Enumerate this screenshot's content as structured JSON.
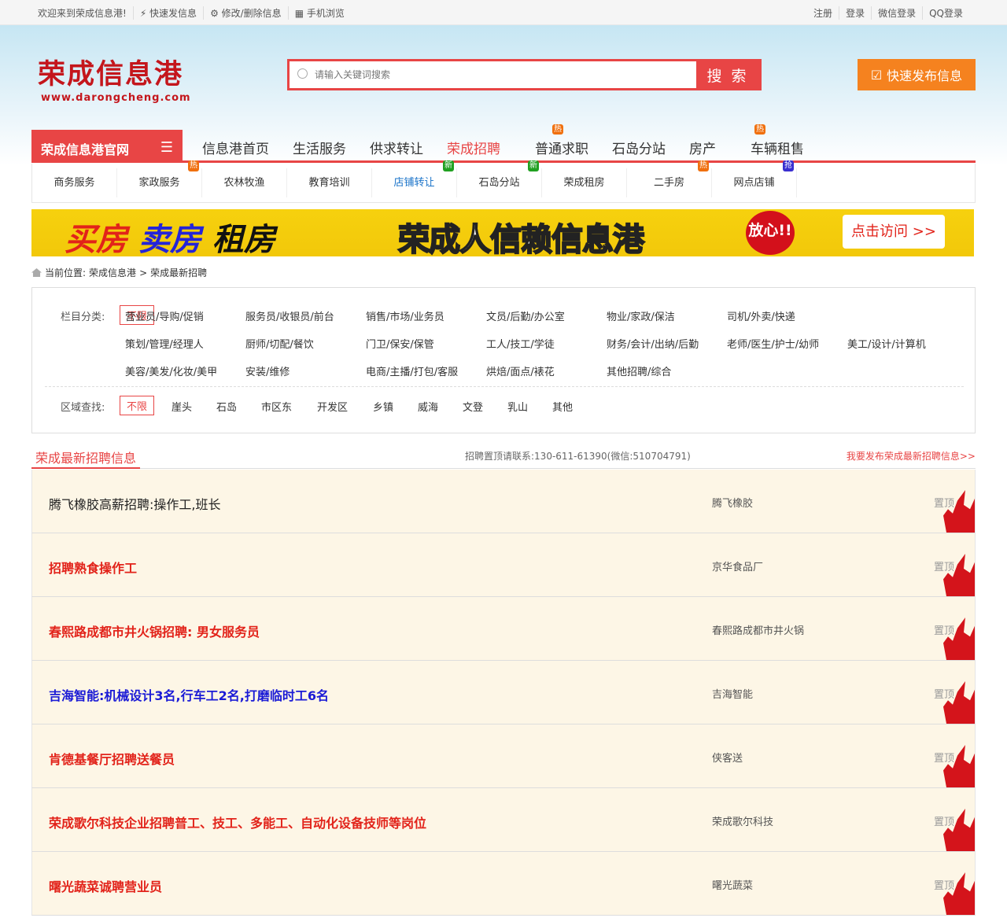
{
  "topbar": {
    "welcome": "欢迎来到荣成信息港!",
    "links": [
      "⚡ 快速发信息",
      "⚙ 修改/删除信息",
      "▦ 手机浏览"
    ],
    "right": [
      "注册",
      "登录",
      "微信登录",
      "QQ登录"
    ]
  },
  "logo": {
    "title": "荣成信息港",
    "url": "www.darongcheng.com"
  },
  "search": {
    "placeholder": "请输入关键词搜索",
    "button": "搜 索"
  },
  "publish": {
    "icon": "☑",
    "label": "快速发布信息"
  },
  "nav": {
    "home": "荣成信息港官网",
    "menu_icon": "☰",
    "items": [
      {
        "label": "信息港首页"
      },
      {
        "label": "生活服务"
      },
      {
        "label": "供求转让"
      },
      {
        "label": "荣成招聘",
        "badge": "热",
        "active": true
      },
      {
        "label": "普通求职"
      },
      {
        "label": "石岛分站"
      },
      {
        "label": "房产",
        "badge": "热"
      },
      {
        "label": "车辆租售"
      }
    ]
  },
  "subnav": [
    {
      "label": "商务服务"
    },
    {
      "label": "家政服务",
      "badge": "热"
    },
    {
      "label": "农林牧渔"
    },
    {
      "label": "教育培训"
    },
    {
      "label": "店铺转让",
      "badge": "新",
      "active": true
    },
    {
      "label": "石岛分站",
      "badge": "新"
    },
    {
      "label": "荣成租房"
    },
    {
      "label": "二手房",
      "badge": "热"
    },
    {
      "label": "网点店铺",
      "badge": "抢"
    }
  ],
  "banner": {
    "buy": "买房",
    "sell": "卖房",
    "rent": "租房",
    "slogan": "荣成人信赖信息港",
    "seal": "放心!!",
    "visit": "点击访问 >>"
  },
  "breadcrumb": {
    "prefix": "当前位置:",
    "home": "荣成信息港",
    "sep": ">",
    "current": "荣成最新招聘"
  },
  "filter": {
    "category_label": "栏目分类:",
    "all": "不限",
    "categories": [
      "营业员/导购/促销",
      "服务员/收银员/前台",
      "销售/市场/业务员",
      "文员/后勤/办公室",
      "物业/家政/保洁",
      "司机/外卖/快递",
      "策划/管理/经理人",
      "厨师/切配/餐饮",
      "门卫/保安/保管",
      "工人/技工/学徒",
      "财务/会计/出纳/后勤",
      "老师/医生/护士/幼师",
      "美工/设计/计算机",
      "美容/美发/化妆/美甲",
      "安装/维修",
      "电商/主播/打包/客服",
      "烘焙/面点/裱花",
      "其他招聘/综合"
    ],
    "area_label": "区域查找:",
    "areas": [
      "崖头",
      "石岛",
      "市区东",
      "开发区",
      "乡镇",
      "威海",
      "文登",
      "乳山",
      "其他"
    ]
  },
  "section": {
    "title": "荣成最新招聘信息",
    "contact": "招聘置顶请联系:130-611-61390(微信:510704791)",
    "post_link": "我要发布荣成最新招聘信息>>"
  },
  "colors": {
    "red": "#e84545",
    "blue": "#1a1ad6",
    "black": "#222222"
  },
  "listings": [
    {
      "title": "腾飞橡胶高薪招聘:操作工,班长",
      "company": "腾飞橡胶",
      "tag": "置顶",
      "color": "#222222",
      "bold": false
    },
    {
      "title": "招聘熟食操作工",
      "company": "京华食品厂",
      "tag": "置顶",
      "color": "#e2231a",
      "bold": true
    },
    {
      "title": "春熙路成都市井火锅招聘: 男女服务员",
      "company": "春熙路成都市井火锅",
      "tag": "置顶",
      "color": "#e2231a",
      "bold": true
    },
    {
      "title": "吉海智能:机械设计3名,行车工2名,打磨临时工6名",
      "company": "吉海智能",
      "tag": "置顶",
      "color": "#1a1ad6",
      "bold": true
    },
    {
      "title": "肯德基餐厅招聘送餐员",
      "company": "侠客送",
      "tag": "置顶",
      "color": "#e2231a",
      "bold": true
    },
    {
      "title": "荣成歌尔科技企业招聘普工、技工、多能工、自动化设备技师等岗位",
      "company": "荣成歌尔科技",
      "tag": "置顶",
      "color": "#e2231a",
      "bold": true
    },
    {
      "title": "曙光蔬菜诚聘营业员",
      "company": "曙光蔬菜",
      "tag": "置顶",
      "color": "#e2231a",
      "bold": true
    }
  ]
}
